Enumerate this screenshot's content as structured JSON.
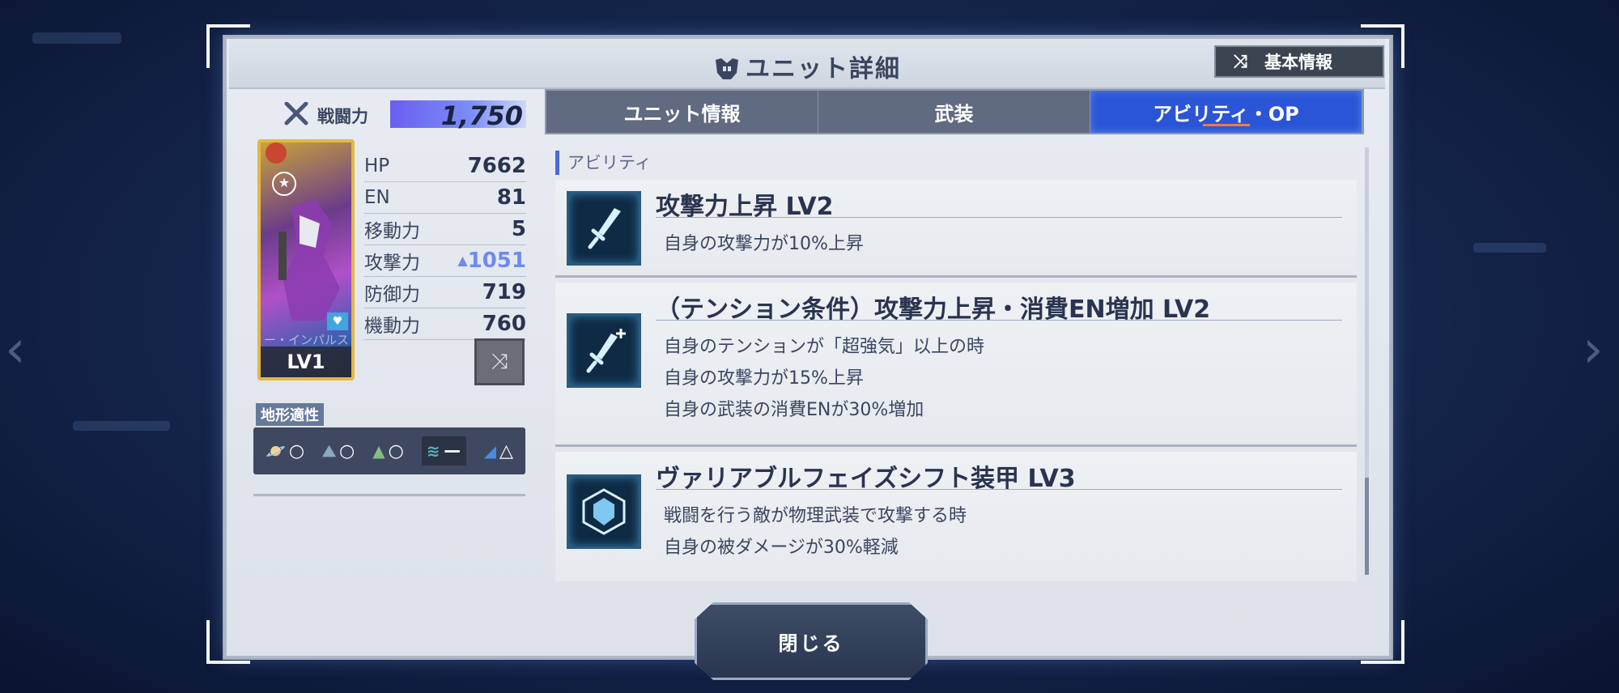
{
  "window": {
    "title": "ユニット詳細",
    "basic_info_label": "基本情報"
  },
  "unit": {
    "power_label": "戦闘力",
    "power_value": "1,750",
    "level": "LV1",
    "name": "ー・インパルス",
    "stats": [
      {
        "key": "HP",
        "value": "7662"
      },
      {
        "key": "EN",
        "value": "81"
      },
      {
        "key": "移動力",
        "value": "5"
      },
      {
        "key": "攻撃力",
        "value": "1051",
        "boosted": true
      },
      {
        "key": "防御力",
        "value": "719"
      },
      {
        "key": "機動力",
        "value": "760"
      }
    ]
  },
  "terrain": {
    "label": "地形適性",
    "items": [
      {
        "icon": "space-icon",
        "rating": "○"
      },
      {
        "icon": "land-icon",
        "rating": "○"
      },
      {
        "icon": "mountain-icon",
        "rating": "○"
      },
      {
        "icon": "water-icon",
        "rating": "ー"
      },
      {
        "icon": "underwater-icon",
        "rating": "△"
      }
    ]
  },
  "tabs": [
    {
      "label": "ユニット情報",
      "active": false
    },
    {
      "label": "武装",
      "active": false
    },
    {
      "label": "アビリティ・OP",
      "active": true
    }
  ],
  "section_title": "アビリティ",
  "abilities": [
    {
      "icon": "sword-icon",
      "name": "攻撃力上昇 LV2",
      "desc": [
        "自身の攻撃力が10%上昇"
      ]
    },
    {
      "icon": "sword-plus-icon",
      "name": "（テンション条件）攻撃力上昇・消費EN増加 LV2",
      "desc": [
        "自身のテンションが「超強気」以上の時",
        "自身の攻撃力が15%上昇",
        "自身の武装の消費ENが30%増加"
      ]
    },
    {
      "icon": "armor-shield-icon",
      "name": "ヴァリアブルフェイズシフト装甲 LV3",
      "desc": [
        "戦闘を行う敵が物理武装で攻撃する時",
        "自身の被ダメージが30%軽減"
      ]
    }
  ],
  "close_label": "閉じる",
  "colors": {
    "accent": "#2a55d6",
    "active_underline": "#f07a3c",
    "stat_boost": "#6f8be8"
  }
}
